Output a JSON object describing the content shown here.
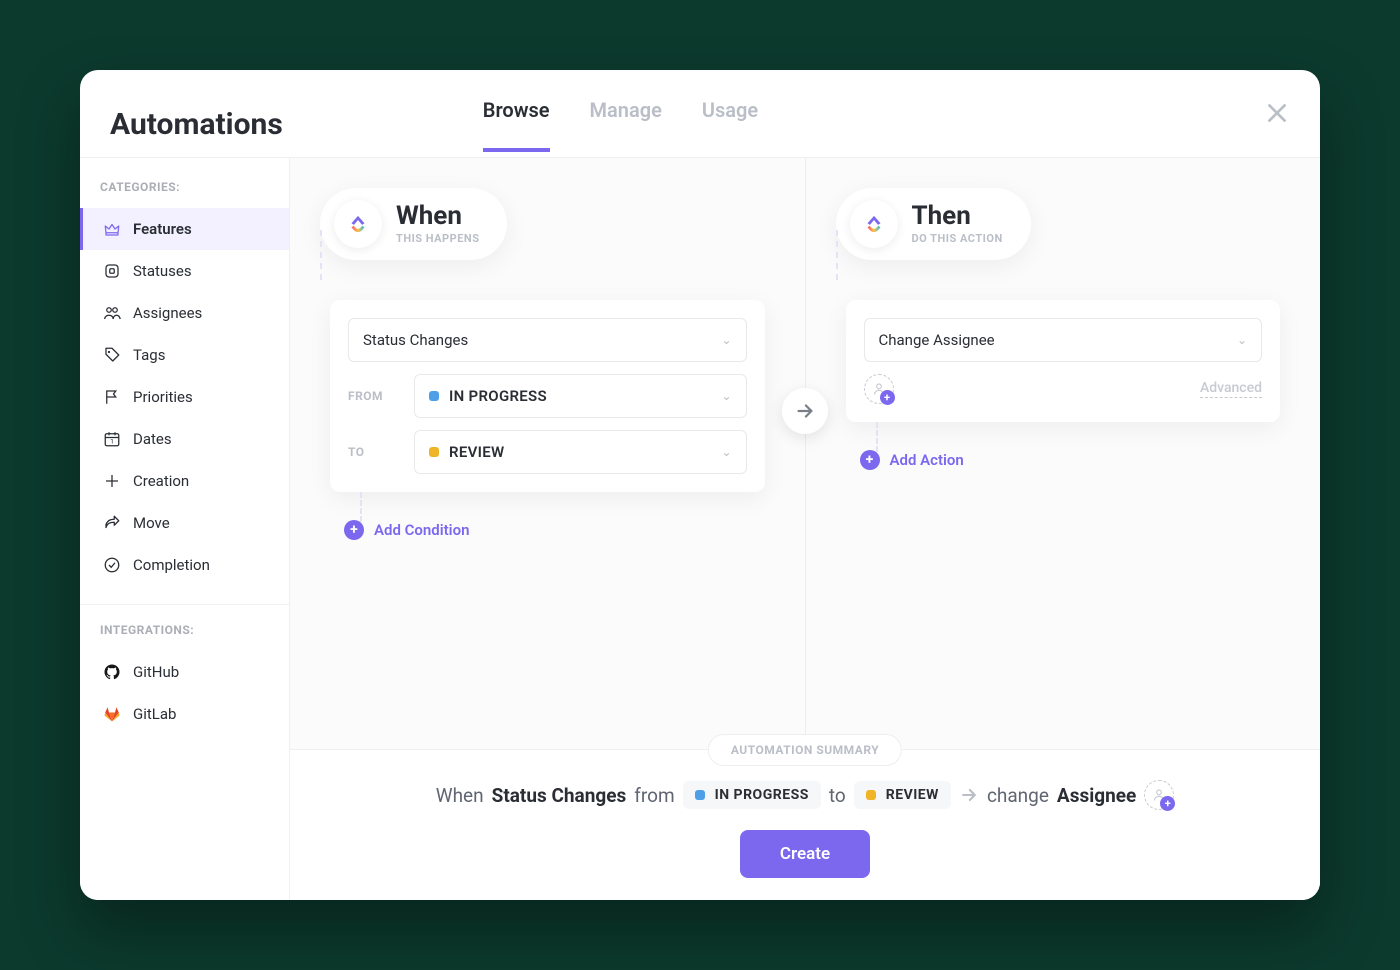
{
  "header": {
    "title": "Automations",
    "tabs": [
      "Browse",
      "Manage",
      "Usage"
    ],
    "active_tab": 0
  },
  "sidebar": {
    "categories_label": "CATEGORIES:",
    "integrations_label": "INTEGRATIONS:",
    "categories": [
      {
        "label": "Features",
        "icon": "crown-icon",
        "active": true
      },
      {
        "label": "Statuses",
        "icon": "square-icon"
      },
      {
        "label": "Assignees",
        "icon": "people-icon"
      },
      {
        "label": "Tags",
        "icon": "tag-icon"
      },
      {
        "label": "Priorities",
        "icon": "flag-icon"
      },
      {
        "label": "Dates",
        "icon": "calendar-icon"
      },
      {
        "label": "Creation",
        "icon": "plus-outline-icon"
      },
      {
        "label": "Move",
        "icon": "share-arrow-icon"
      },
      {
        "label": "Completion",
        "icon": "check-circle-icon"
      }
    ],
    "integrations": [
      {
        "label": "GitHub",
        "icon": "github-icon"
      },
      {
        "label": "GitLab",
        "icon": "gitlab-icon"
      }
    ]
  },
  "when": {
    "title": "When",
    "subtitle": "THIS HAPPENS",
    "trigger": "Status Changes",
    "from_label": "FROM",
    "from_status": "IN PROGRESS",
    "from_color": "#4f9ee8",
    "to_label": "TO",
    "to_status": "REVIEW",
    "to_color": "#f0b429",
    "add_condition": "Add Condition"
  },
  "then": {
    "title": "Then",
    "subtitle": "DO THIS ACTION",
    "action": "Change Assignee",
    "advanced": "Advanced",
    "add_action": "Add Action"
  },
  "summary": {
    "chip": "AUTOMATION SUMMARY",
    "when_word": "When",
    "trigger_bold": "Status Changes",
    "from_word": "from",
    "from_status": "IN PROGRESS",
    "from_color": "#4f9ee8",
    "to_word": "to",
    "to_status": "REVIEW",
    "to_color": "#f0b429",
    "change_word": "change",
    "assignee_bold": "Assignee",
    "create": "Create"
  }
}
